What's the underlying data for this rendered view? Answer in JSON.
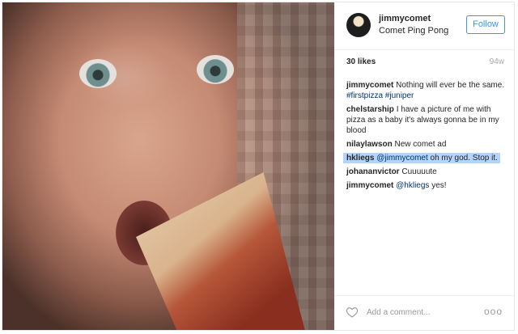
{
  "photo": {
    "alt_icon": "photo-baby-eating-pizza"
  },
  "header": {
    "username": "jimmycomet",
    "location": "Comet Ping Pong",
    "follow_label": "Follow"
  },
  "meta": {
    "likes": "30 likes",
    "age": "94w"
  },
  "comments": [
    {
      "user": "jimmycomet",
      "text": "Nothing will ever be the same.",
      "tags": "#firstpizza #juniper"
    },
    {
      "user": "chelstarship",
      "text": "I have a picture of me with pizza as a baby it's always gonna be in my blood"
    },
    {
      "user": "nilaylawson",
      "text": "New comet ad"
    },
    {
      "user": "hkliegs",
      "mention": "@jimmycomet",
      "text": "oh my god. Stop it."
    },
    {
      "user": "johananvictor",
      "text": "Cuuuuute"
    },
    {
      "user": "jimmycomet",
      "mention": "@hkliegs",
      "text": "yes!"
    }
  ],
  "footer": {
    "placeholder": "Add a comment...",
    "more": "ooo",
    "heart_icon": "heart-icon"
  },
  "colors": {
    "accent": "#3897f0",
    "selection": "#b3d4fc",
    "tag": "#003569"
  }
}
